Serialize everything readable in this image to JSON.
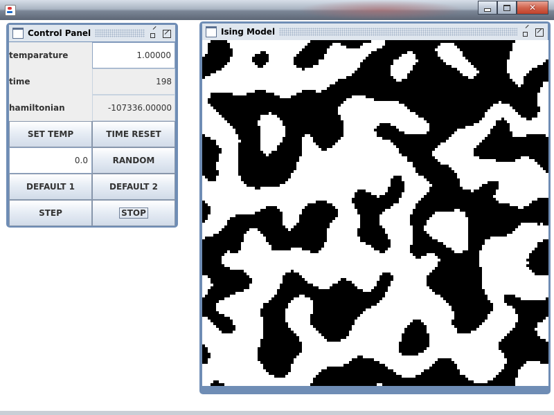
{
  "window": {
    "icon": "java-icon",
    "buttons": [
      "minimize-icon",
      "maximize-icon",
      "close-icon"
    ]
  },
  "control_panel": {
    "title": "Control Panel",
    "temperature": {
      "label": "temparature",
      "value": "1.00000"
    },
    "time": {
      "label": "time",
      "value": "198"
    },
    "hamiltonian": {
      "label": "hamiltonian",
      "value": "-107336.00000"
    },
    "set_temp_label": "SET TEMP",
    "time_reset_label": "TIME RESET",
    "random_value": "0.0",
    "random_label": "RANDOM",
    "default1_label": "DEFAULT 1",
    "default2_label": "DEFAULT 2",
    "step_label": "STEP",
    "stop_label": "STOP"
  },
  "ising_model": {
    "title": "Ising Model",
    "colors": {
      "spin_up": "#ffffff",
      "spin_down": "#000000"
    }
  }
}
